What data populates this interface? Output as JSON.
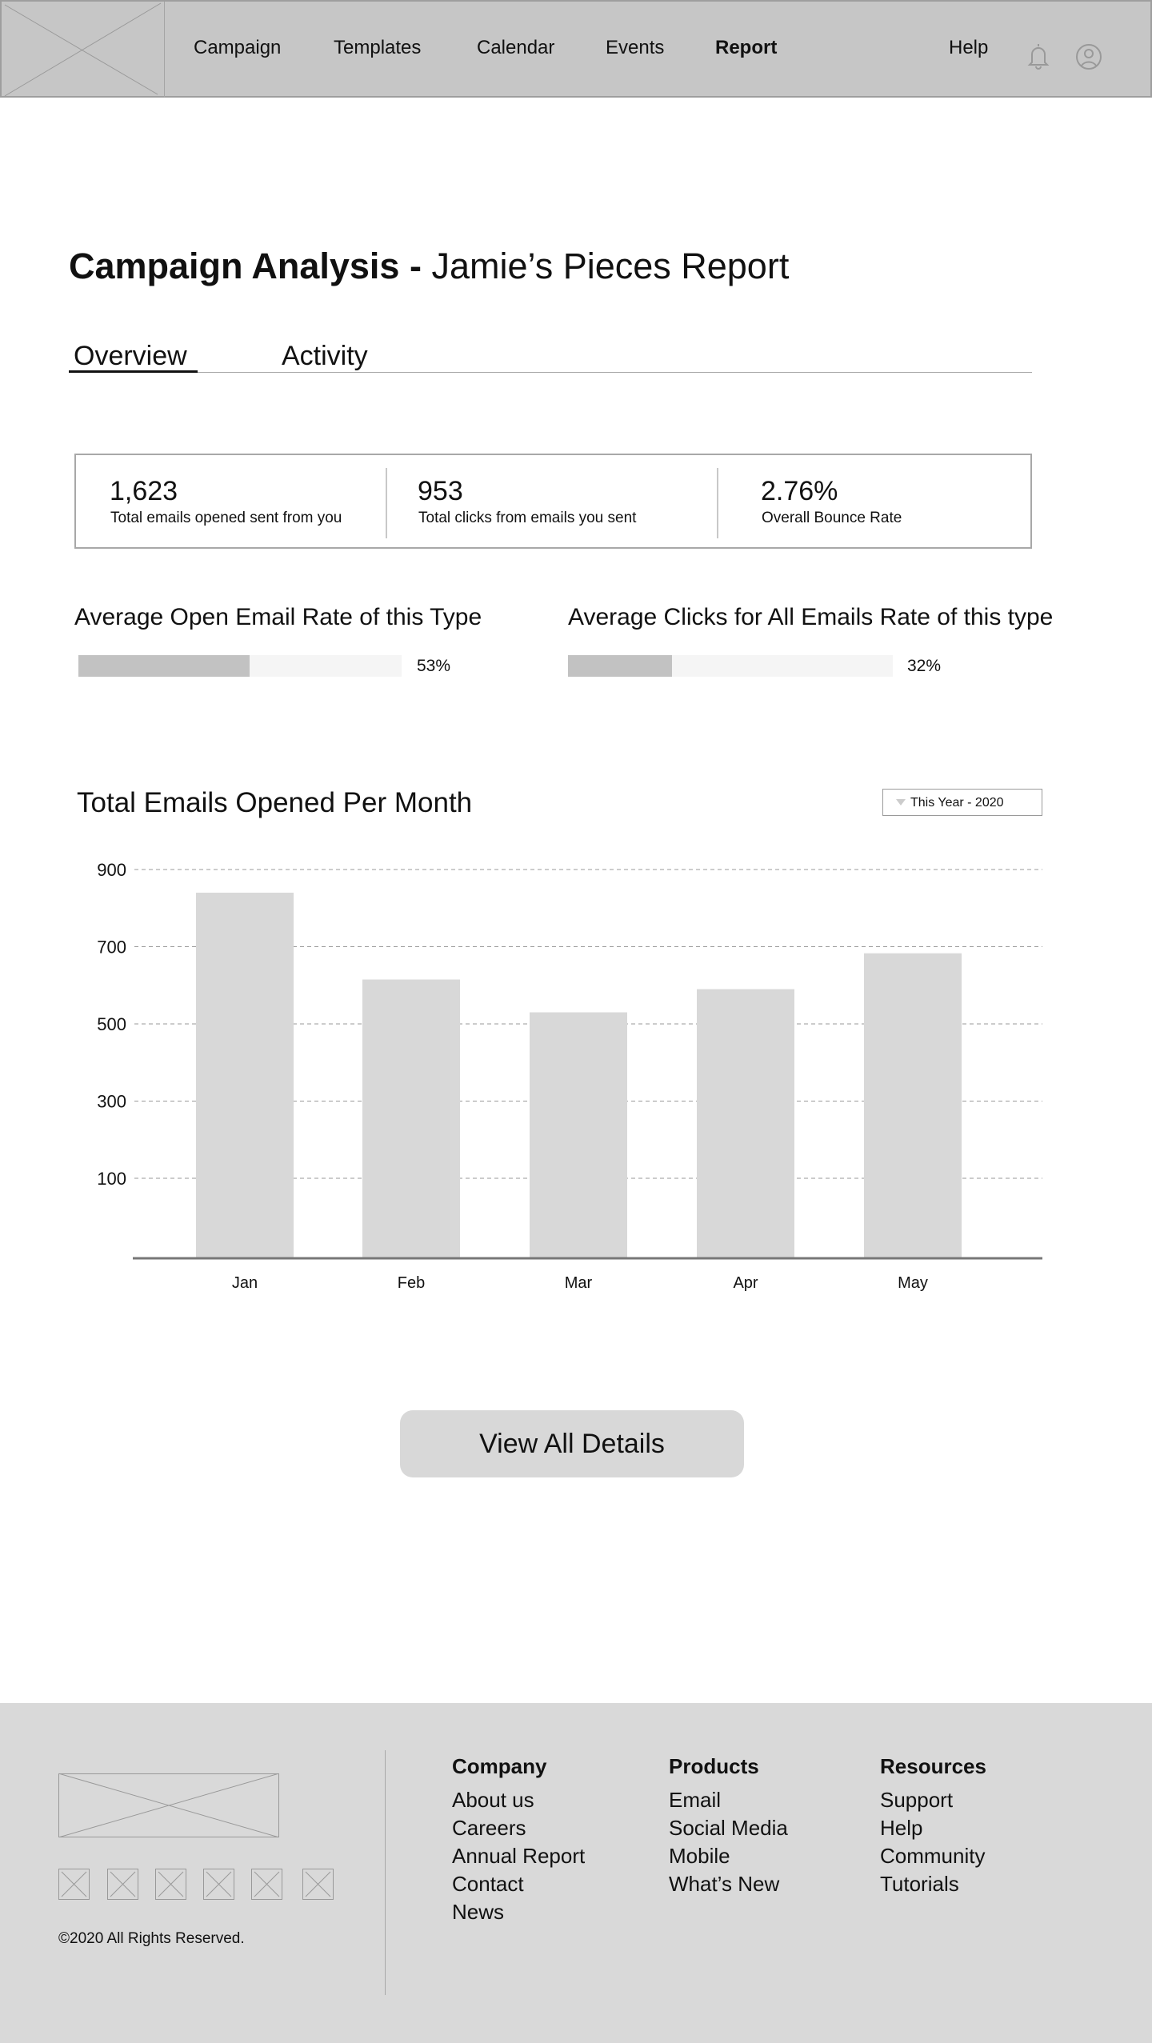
{
  "nav": {
    "items": [
      "Campaign",
      "Templates",
      "Calendar",
      "Events",
      "Report"
    ],
    "active": "Report",
    "help": "Help",
    "icons": [
      "bell-icon",
      "user-icon"
    ]
  },
  "page": {
    "title_bold": "Campaign Analysis -",
    "title_rest": "Jamie’s Pieces Report",
    "tabs": [
      "Overview",
      "Activity"
    ]
  },
  "stats": [
    {
      "value": "1,623",
      "label": "Total emails opened sent from you"
    },
    {
      "value": "953",
      "label": "Total clicks from emails you sent"
    },
    {
      "value": "2.76%",
      "label": "Overall Bounce Rate"
    }
  ],
  "progress": [
    {
      "title": "Average Open Email Rate of this Type",
      "percent": 53,
      "label": "53%"
    },
    {
      "title": "Average Clicks for All Emails Rate of this type",
      "percent": 32,
      "label": "32%"
    }
  ],
  "chart_data": {
    "type": "bar",
    "title": "Total Emails Opened Per Month",
    "filter": "This Year - 2020",
    "categories": [
      "Jan",
      "Feb",
      "Mar",
      "Apr",
      "May"
    ],
    "values": [
      840,
      615,
      530,
      590,
      683
    ],
    "yticks": [
      900,
      700,
      500,
      300,
      100
    ],
    "ylim": [
      -100,
      900
    ],
    "grid": true,
    "xlabel": "",
    "ylabel": ""
  },
  "actions": {
    "view_all": "View All Details"
  },
  "footer": {
    "copyright": "©2020 All Rights Reserved.",
    "columns": [
      {
        "heading": "Company",
        "links": [
          "About us",
          "Careers",
          "Annual Report",
          "Contact",
          "News"
        ]
      },
      {
        "heading": "Products",
        "links": [
          "Email",
          "Social Media",
          "Mobile",
          "What’s New"
        ]
      },
      {
        "heading": "Resources",
        "links": [
          "Support",
          "Help",
          "Community",
          "Tutorials"
        ]
      }
    ],
    "colors": {
      "bg": "#d9d9d9",
      "nav_bg": "#c6c6c6",
      "bar": "#d8d8d8"
    }
  }
}
